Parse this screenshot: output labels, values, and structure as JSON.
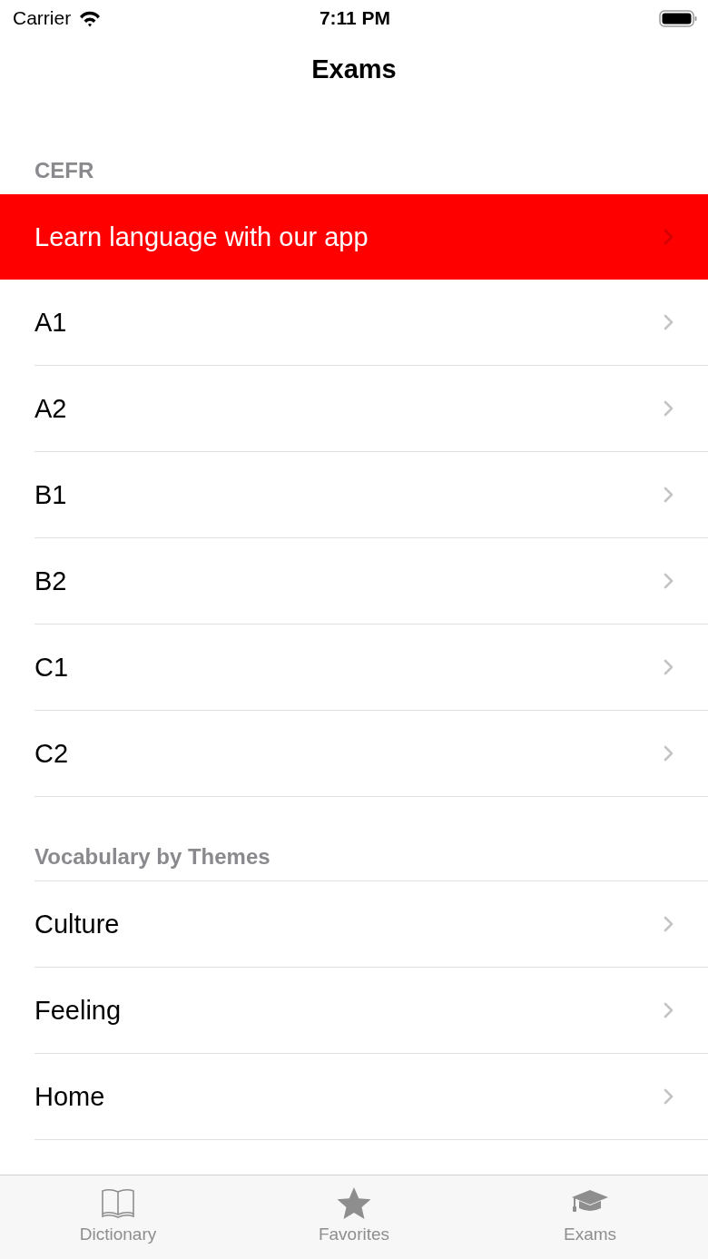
{
  "status_bar": {
    "carrier": "Carrier",
    "time": "7:11 PM"
  },
  "nav": {
    "title": "Exams"
  },
  "sections": [
    {
      "header": "CEFR",
      "items": [
        {
          "label": "Learn language with our app",
          "kind": "promo"
        },
        {
          "label": "A1",
          "kind": "plain"
        },
        {
          "label": "A2",
          "kind": "plain"
        },
        {
          "label": "B1",
          "kind": "plain"
        },
        {
          "label": "B2",
          "kind": "plain"
        },
        {
          "label": "C1",
          "kind": "plain"
        },
        {
          "label": "C2",
          "kind": "plain"
        }
      ]
    },
    {
      "header": "Vocabulary by Themes",
      "items": [
        {
          "label": "Culture",
          "kind": "plain"
        },
        {
          "label": "Feeling",
          "kind": "plain"
        },
        {
          "label": "Home",
          "kind": "plain"
        }
      ]
    }
  ],
  "tab_bar": [
    {
      "label": "Dictionary",
      "kind": "book"
    },
    {
      "label": "Favorites",
      "kind": "star"
    },
    {
      "label": "Exams",
      "kind": "cap"
    }
  ]
}
